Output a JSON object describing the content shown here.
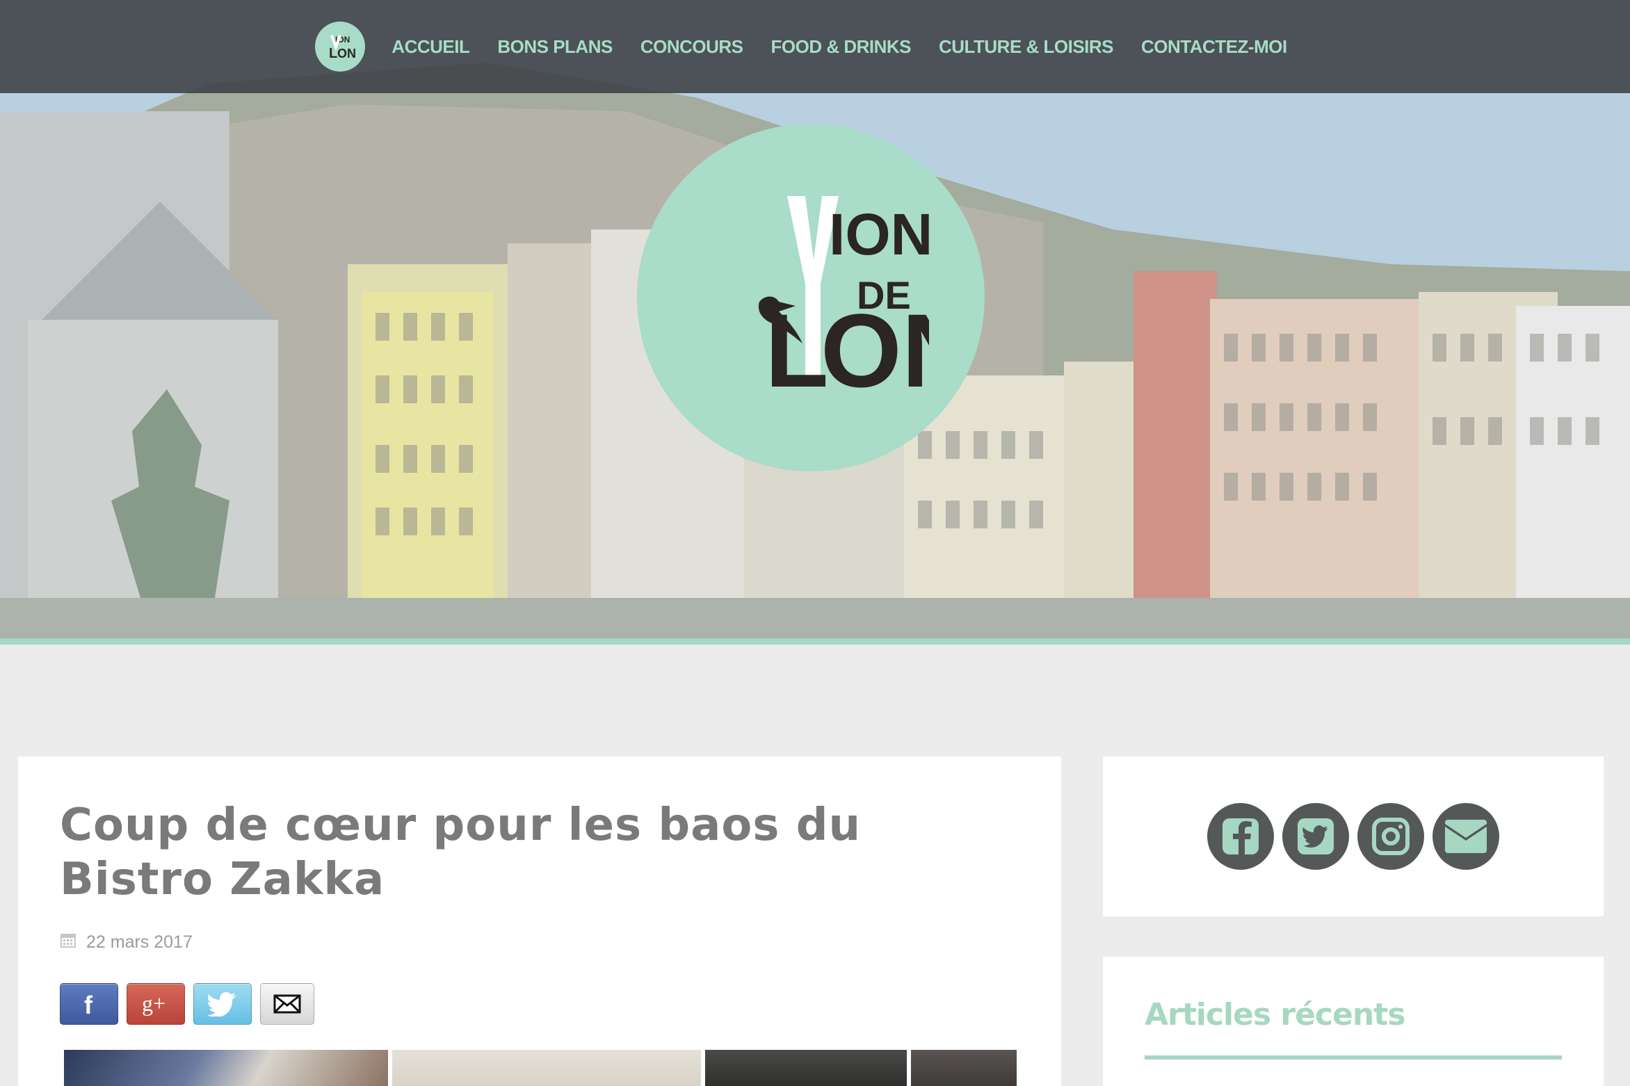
{
  "nav": {
    "logo_alt": "Vion de Lyon",
    "items": [
      {
        "label": "ACCUEIL"
      },
      {
        "label": "BONS PLANS"
      },
      {
        "label": "CONCOURS"
      },
      {
        "label": "FOOD & DRINKS"
      },
      {
        "label": "CULTURE & LOISIRS"
      },
      {
        "label": "CONTACTEZ-MOI"
      }
    ]
  },
  "hero": {
    "logo_lines": [
      "ION",
      "DE",
      "L",
      "ON"
    ]
  },
  "post": {
    "title": "Coup de cœur pour les baos du Bistro Zakka",
    "date": "22 mars 2017",
    "share_buttons": [
      "facebook-share",
      "google-plus-share",
      "twitter-share",
      "email-share"
    ]
  },
  "sidebar": {
    "social_icons": [
      "facebook-icon",
      "twitter-icon",
      "instagram-icon",
      "email-icon"
    ],
    "recent_title": "Articles récents"
  },
  "colors": {
    "mint": "#a8dcc7",
    "nav_bg": "#3c4044",
    "title_gray": "#7a7a7a",
    "social_dark": "#555859"
  }
}
